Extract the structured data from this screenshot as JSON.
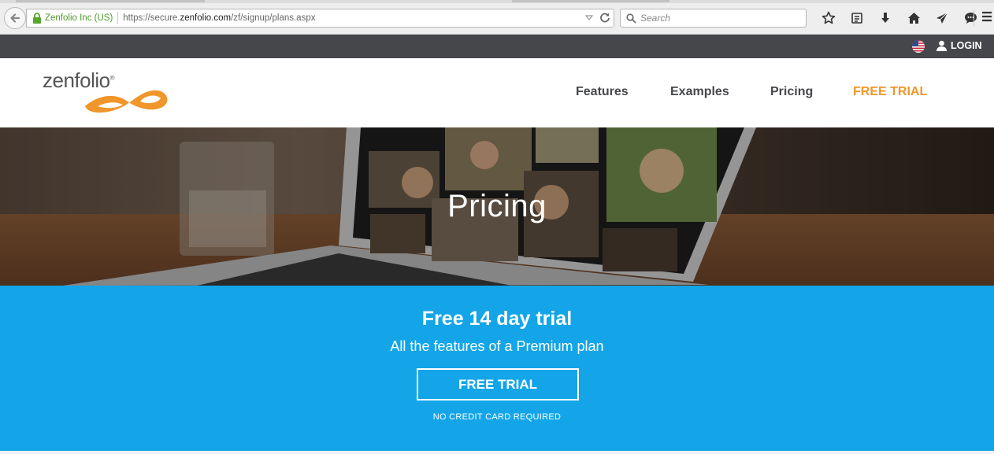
{
  "browser": {
    "identity": "Zenfolio Inc (US)",
    "url_prefix": "https://secure.",
    "url_domain": "zenfolio.com",
    "url_path": "/zf/signup/plans.aspx",
    "search_placeholder": "Search",
    "toolbar_icons": [
      "bookmark-star-icon",
      "reading-list-icon",
      "download-icon",
      "home-icon",
      "share-icon",
      "chat-icon",
      "menu-icon"
    ]
  },
  "topbar": {
    "login_label": "LOGIN",
    "flag": "us-flag-icon"
  },
  "header": {
    "logo_text": "zenfolio",
    "logo_reg": "®",
    "nav": [
      {
        "label": "Features"
      },
      {
        "label": "Examples"
      },
      {
        "label": "Pricing"
      },
      {
        "label": "FREE TRIAL"
      }
    ],
    "accent_color": "#f0962a",
    "nav_color": "#46474b"
  },
  "hero": {
    "title": "Pricing"
  },
  "trial_band": {
    "title": "Free 14 day trial",
    "subtitle": "All the features of a Premium plan",
    "button_label": "FREE TRIAL",
    "note": "NO CREDIT CARD REQUIRED",
    "background_color": "#13a5e8"
  }
}
